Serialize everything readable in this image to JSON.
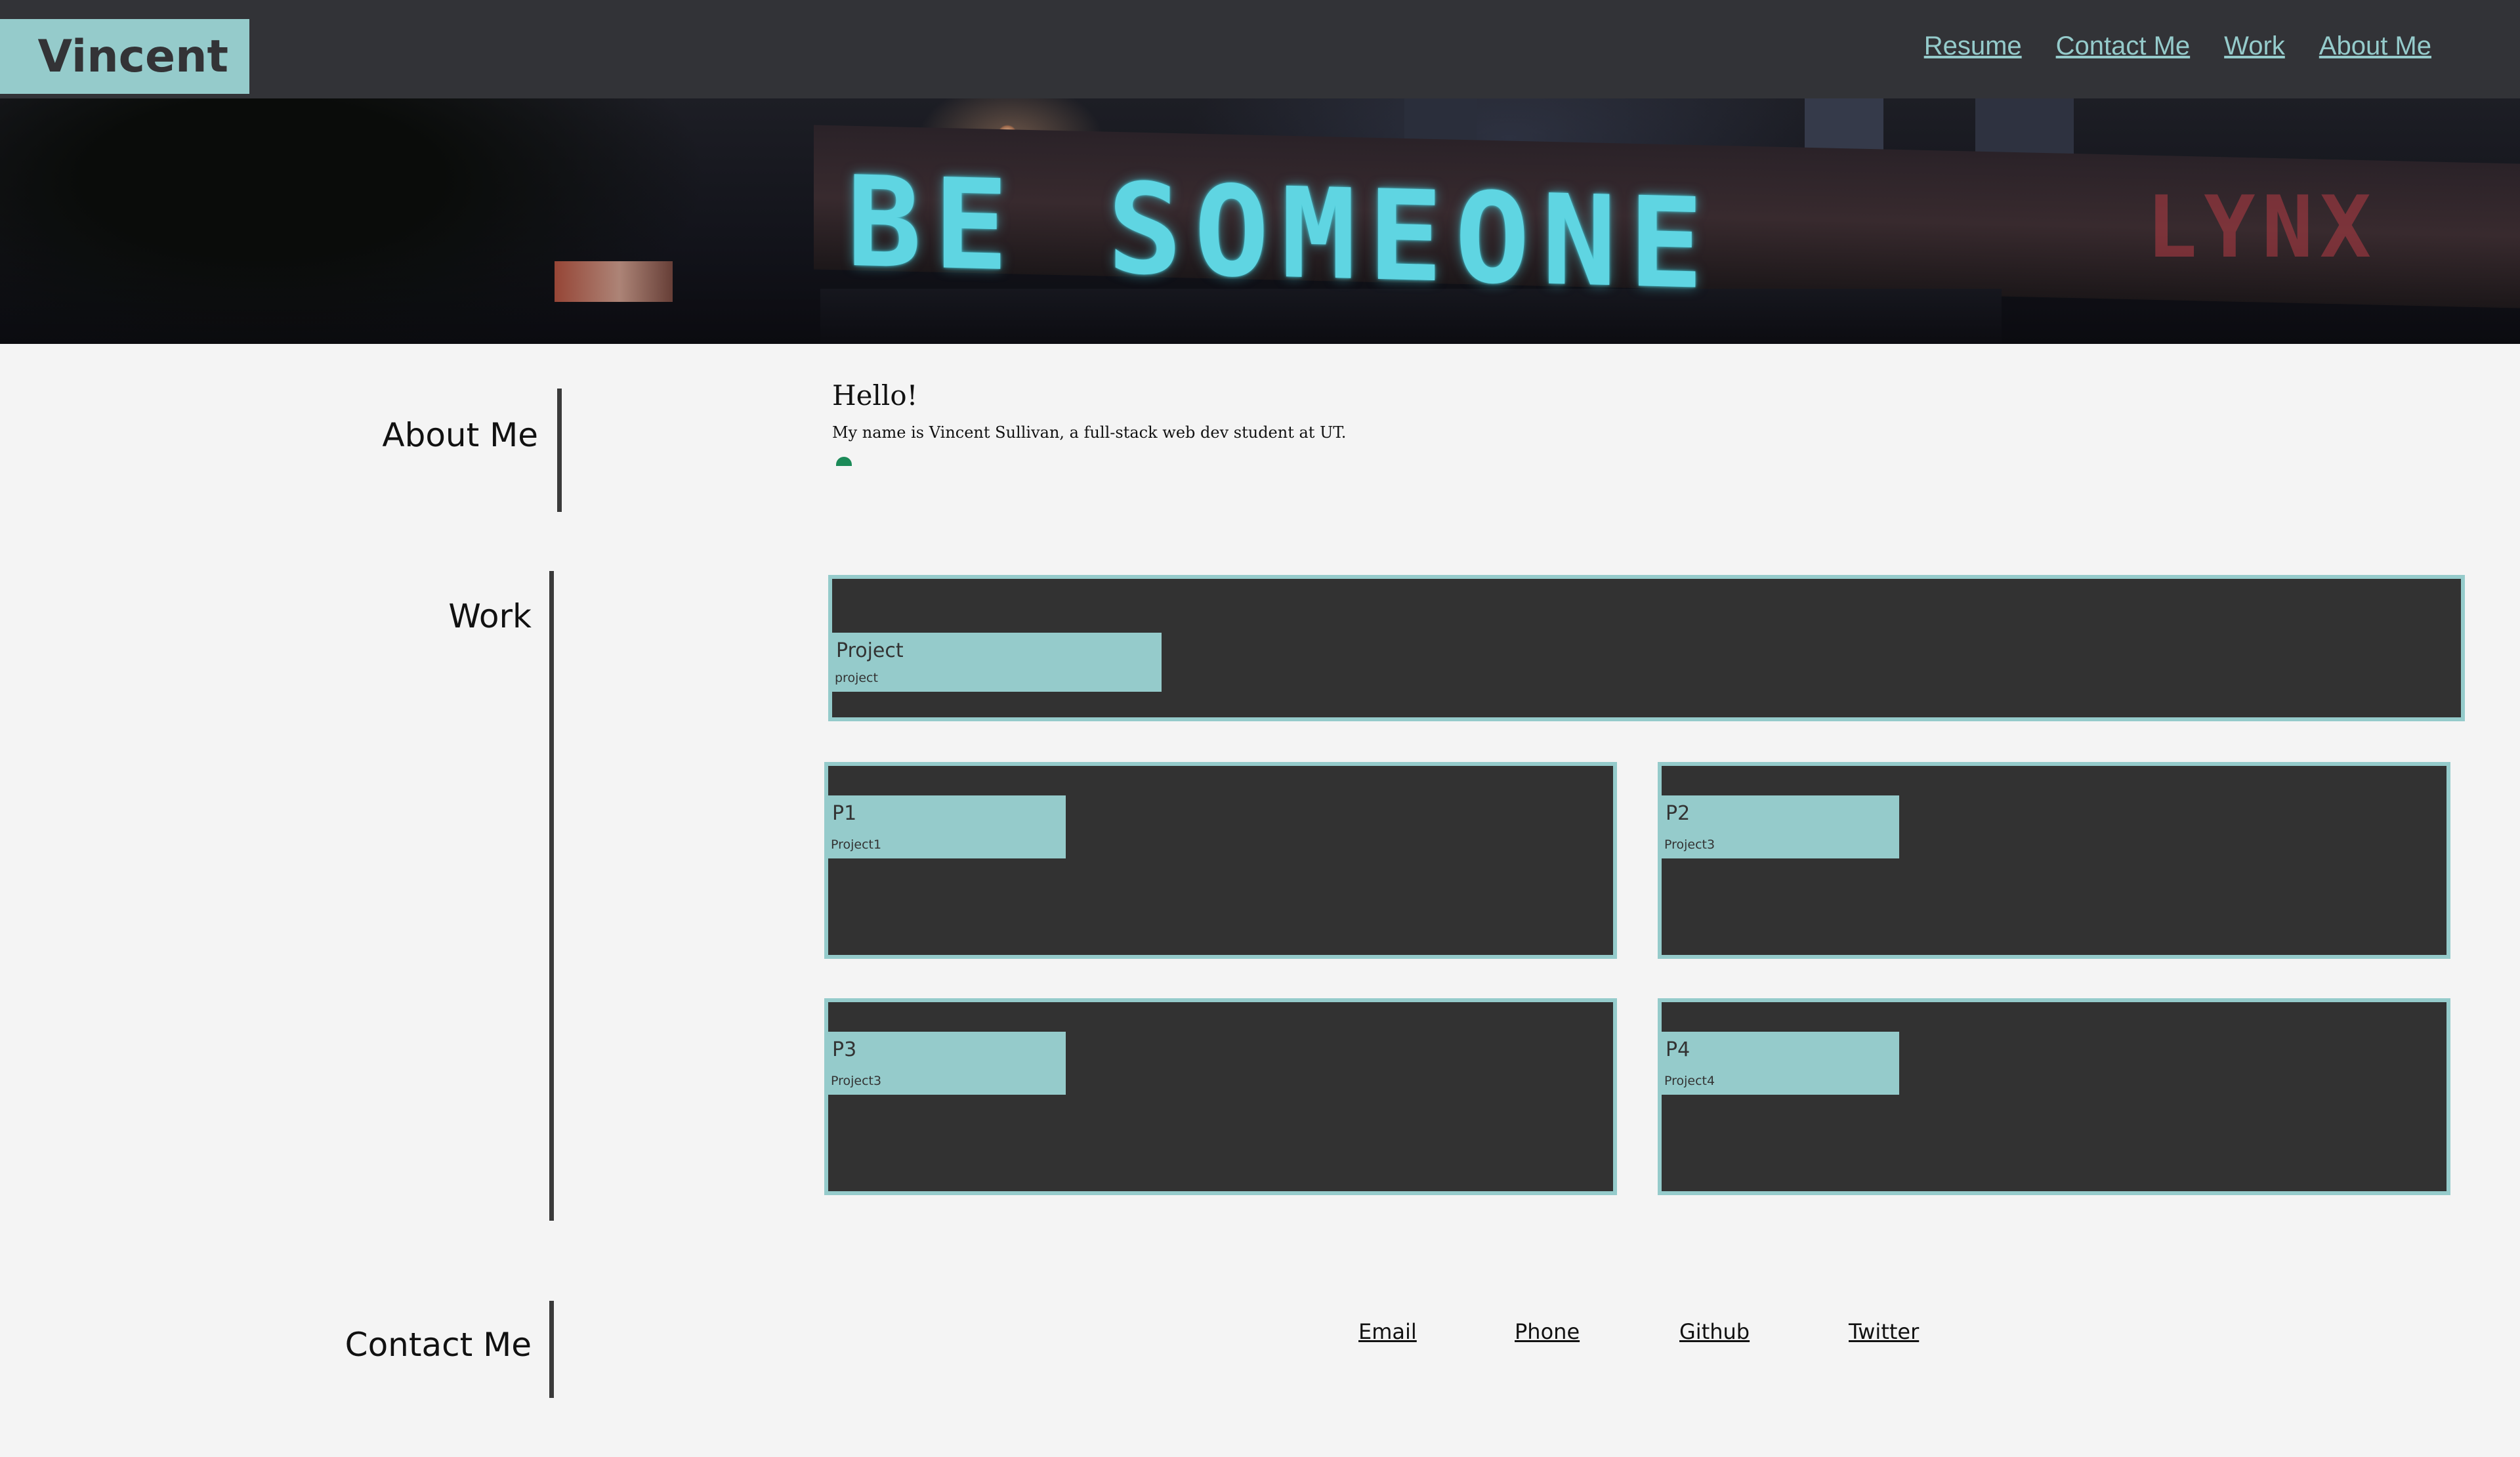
{
  "header": {
    "brand": "Vincent",
    "nav": [
      "Resume",
      "Contact Me",
      "Work",
      "About Me"
    ]
  },
  "hero": {
    "slogan": "BE SOMEONE",
    "graffiti": "LYNX"
  },
  "about": {
    "title": "About Me",
    "greeting": "Hello!",
    "intro": "My name is Vincent Sullivan, a full-stack web dev student at UT."
  },
  "work": {
    "title": "Work",
    "featured": {
      "name": "Project",
      "sub": "project"
    },
    "projects": [
      {
        "name": "P1",
        "sub": "Project1"
      },
      {
        "name": "P2",
        "sub": "Project3"
      },
      {
        "name": "P3",
        "sub": "Project3"
      },
      {
        "name": "P4",
        "sub": "Project4"
      }
    ]
  },
  "contact": {
    "title": "Contact Me",
    "links": [
      "Email",
      "Phone",
      "Github",
      "Twitter"
    ]
  },
  "colors": {
    "accent": "#95cbcb",
    "header_bg": "#323337",
    "card_bg": "#323232",
    "page_bg": "#f4f4f4"
  }
}
